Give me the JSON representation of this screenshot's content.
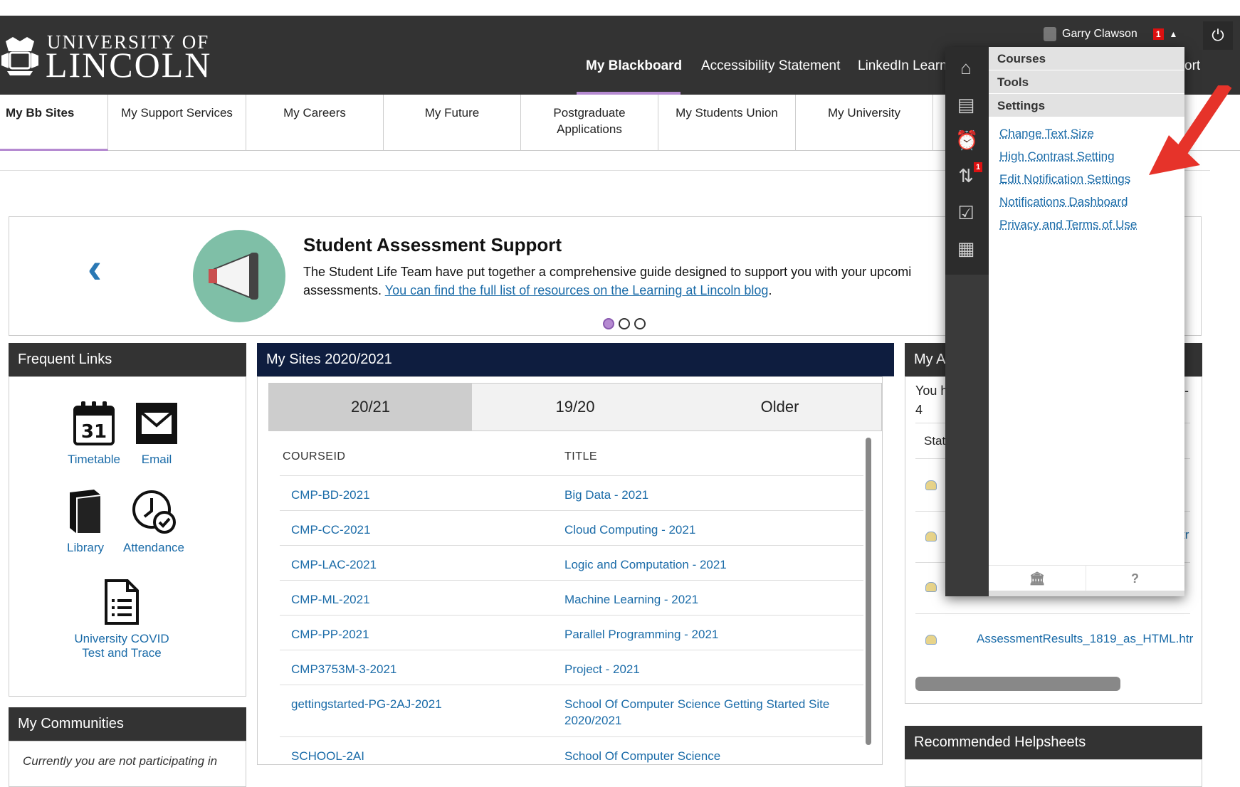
{
  "brand": {
    "line1": "UNIVERSITY OF",
    "line2": "LINCOLN"
  },
  "top_nav": [
    {
      "label": "My Blackboard",
      "active": true
    },
    {
      "label": "Accessibility Statement"
    },
    {
      "label": "LinkedIn Learn"
    },
    {
      "label": "ort"
    }
  ],
  "user": {
    "name": "Garry Clawson",
    "notification_count": "1",
    "caret_icon": "caret-up-icon"
  },
  "tabs": [
    {
      "label": "My Bb Sites",
      "active": true
    },
    {
      "label": "My Support Services"
    },
    {
      "label": "My Careers"
    },
    {
      "label": "My Future"
    },
    {
      "label": "Postgraduate Applications"
    },
    {
      "label": "My Students Union"
    },
    {
      "label": "My University"
    }
  ],
  "carousel": {
    "title": "Student Assessment Support",
    "text_before": "The Student Life Team have put together a comprehensive guide designed to support you with your upcomi",
    "text_line2": "assessments.",
    "link_text": "You can find the full list of resources on the Learning at Lincoln blog",
    "text_after": ".",
    "dots": [
      true,
      false,
      false
    ]
  },
  "frequent_links": {
    "title": "Frequent Links",
    "items": [
      {
        "label": "Timetable",
        "icon": "calendar-icon",
        "calendar_day": "31"
      },
      {
        "label": "Email",
        "icon": "envelope-icon"
      },
      {
        "label": "Library",
        "icon": "book-icon"
      },
      {
        "label": "Attendance",
        "icon": "clock-check-icon"
      },
      {
        "label": "University COVID",
        "label2": "Test and Trace",
        "icon": "document-icon"
      }
    ]
  },
  "communities": {
    "title": "My Communities",
    "text": "Currently you are not participating in"
  },
  "my_sites": {
    "title": "My Sites 2020/2021",
    "tabs": [
      {
        "label": "20/21",
        "active": true
      },
      {
        "label": "19/20"
      },
      {
        "label": "Older"
      }
    ],
    "columns": [
      "COURSEID",
      "TITLE"
    ],
    "rows": [
      {
        "id": "CMP-BD-2021",
        "title": "Big Data - 2021"
      },
      {
        "id": "CMP-CC-2021",
        "title": "Cloud Computing - 2021"
      },
      {
        "id": "CMP-LAC-2021",
        "title": "Logic and Computation - 2021"
      },
      {
        "id": "CMP-ML-2021",
        "title": "Machine Learning - 2021"
      },
      {
        "id": "CMP-PP-2021",
        "title": "Parallel Programming - 2021"
      },
      {
        "id": "CMP3753M-3-2021",
        "title": "Project - 2021"
      },
      {
        "id": "gettingstarted-PG-2AJ-2021",
        "title": "School Of Computer Science Getting Started Site",
        "title2": "2020/2021"
      },
      {
        "id": "SCHOOL-2AI",
        "title": "School Of Computer Science"
      }
    ]
  },
  "right_module": {
    "title": "My A",
    "line1": "You h",
    "line1_tail": "-",
    "line2": "4",
    "status_label": "Stat",
    "partial_link": "tr",
    "file_link": "AssessmentResults_1819_as_HTML.htr"
  },
  "helpsheets": {
    "title": "Recommended Helpsheets"
  },
  "menu": {
    "sections": [
      "Courses",
      "Tools",
      "Settings"
    ],
    "links": [
      "Change Text Size",
      "High Contrast Setting",
      "Edit Notification Settings",
      "Notifications Dashboard",
      "Privacy and Terms of Use"
    ],
    "side_icons": [
      "bb-home-icon",
      "inbox-icon",
      "alarm-icon",
      "updates-icon",
      "grades-icon",
      "calendar-icon"
    ],
    "side_badge": "1",
    "footer": [
      {
        "icon": "home-icon",
        "glyph": "🏛"
      },
      {
        "icon": "help-icon",
        "glyph": "?"
      }
    ]
  },
  "colors": {
    "header": "#333333",
    "accent": "#b58ad1",
    "link": "#1a6ba8",
    "navy": "#0e1d3f",
    "arrow": "#e6332a"
  }
}
